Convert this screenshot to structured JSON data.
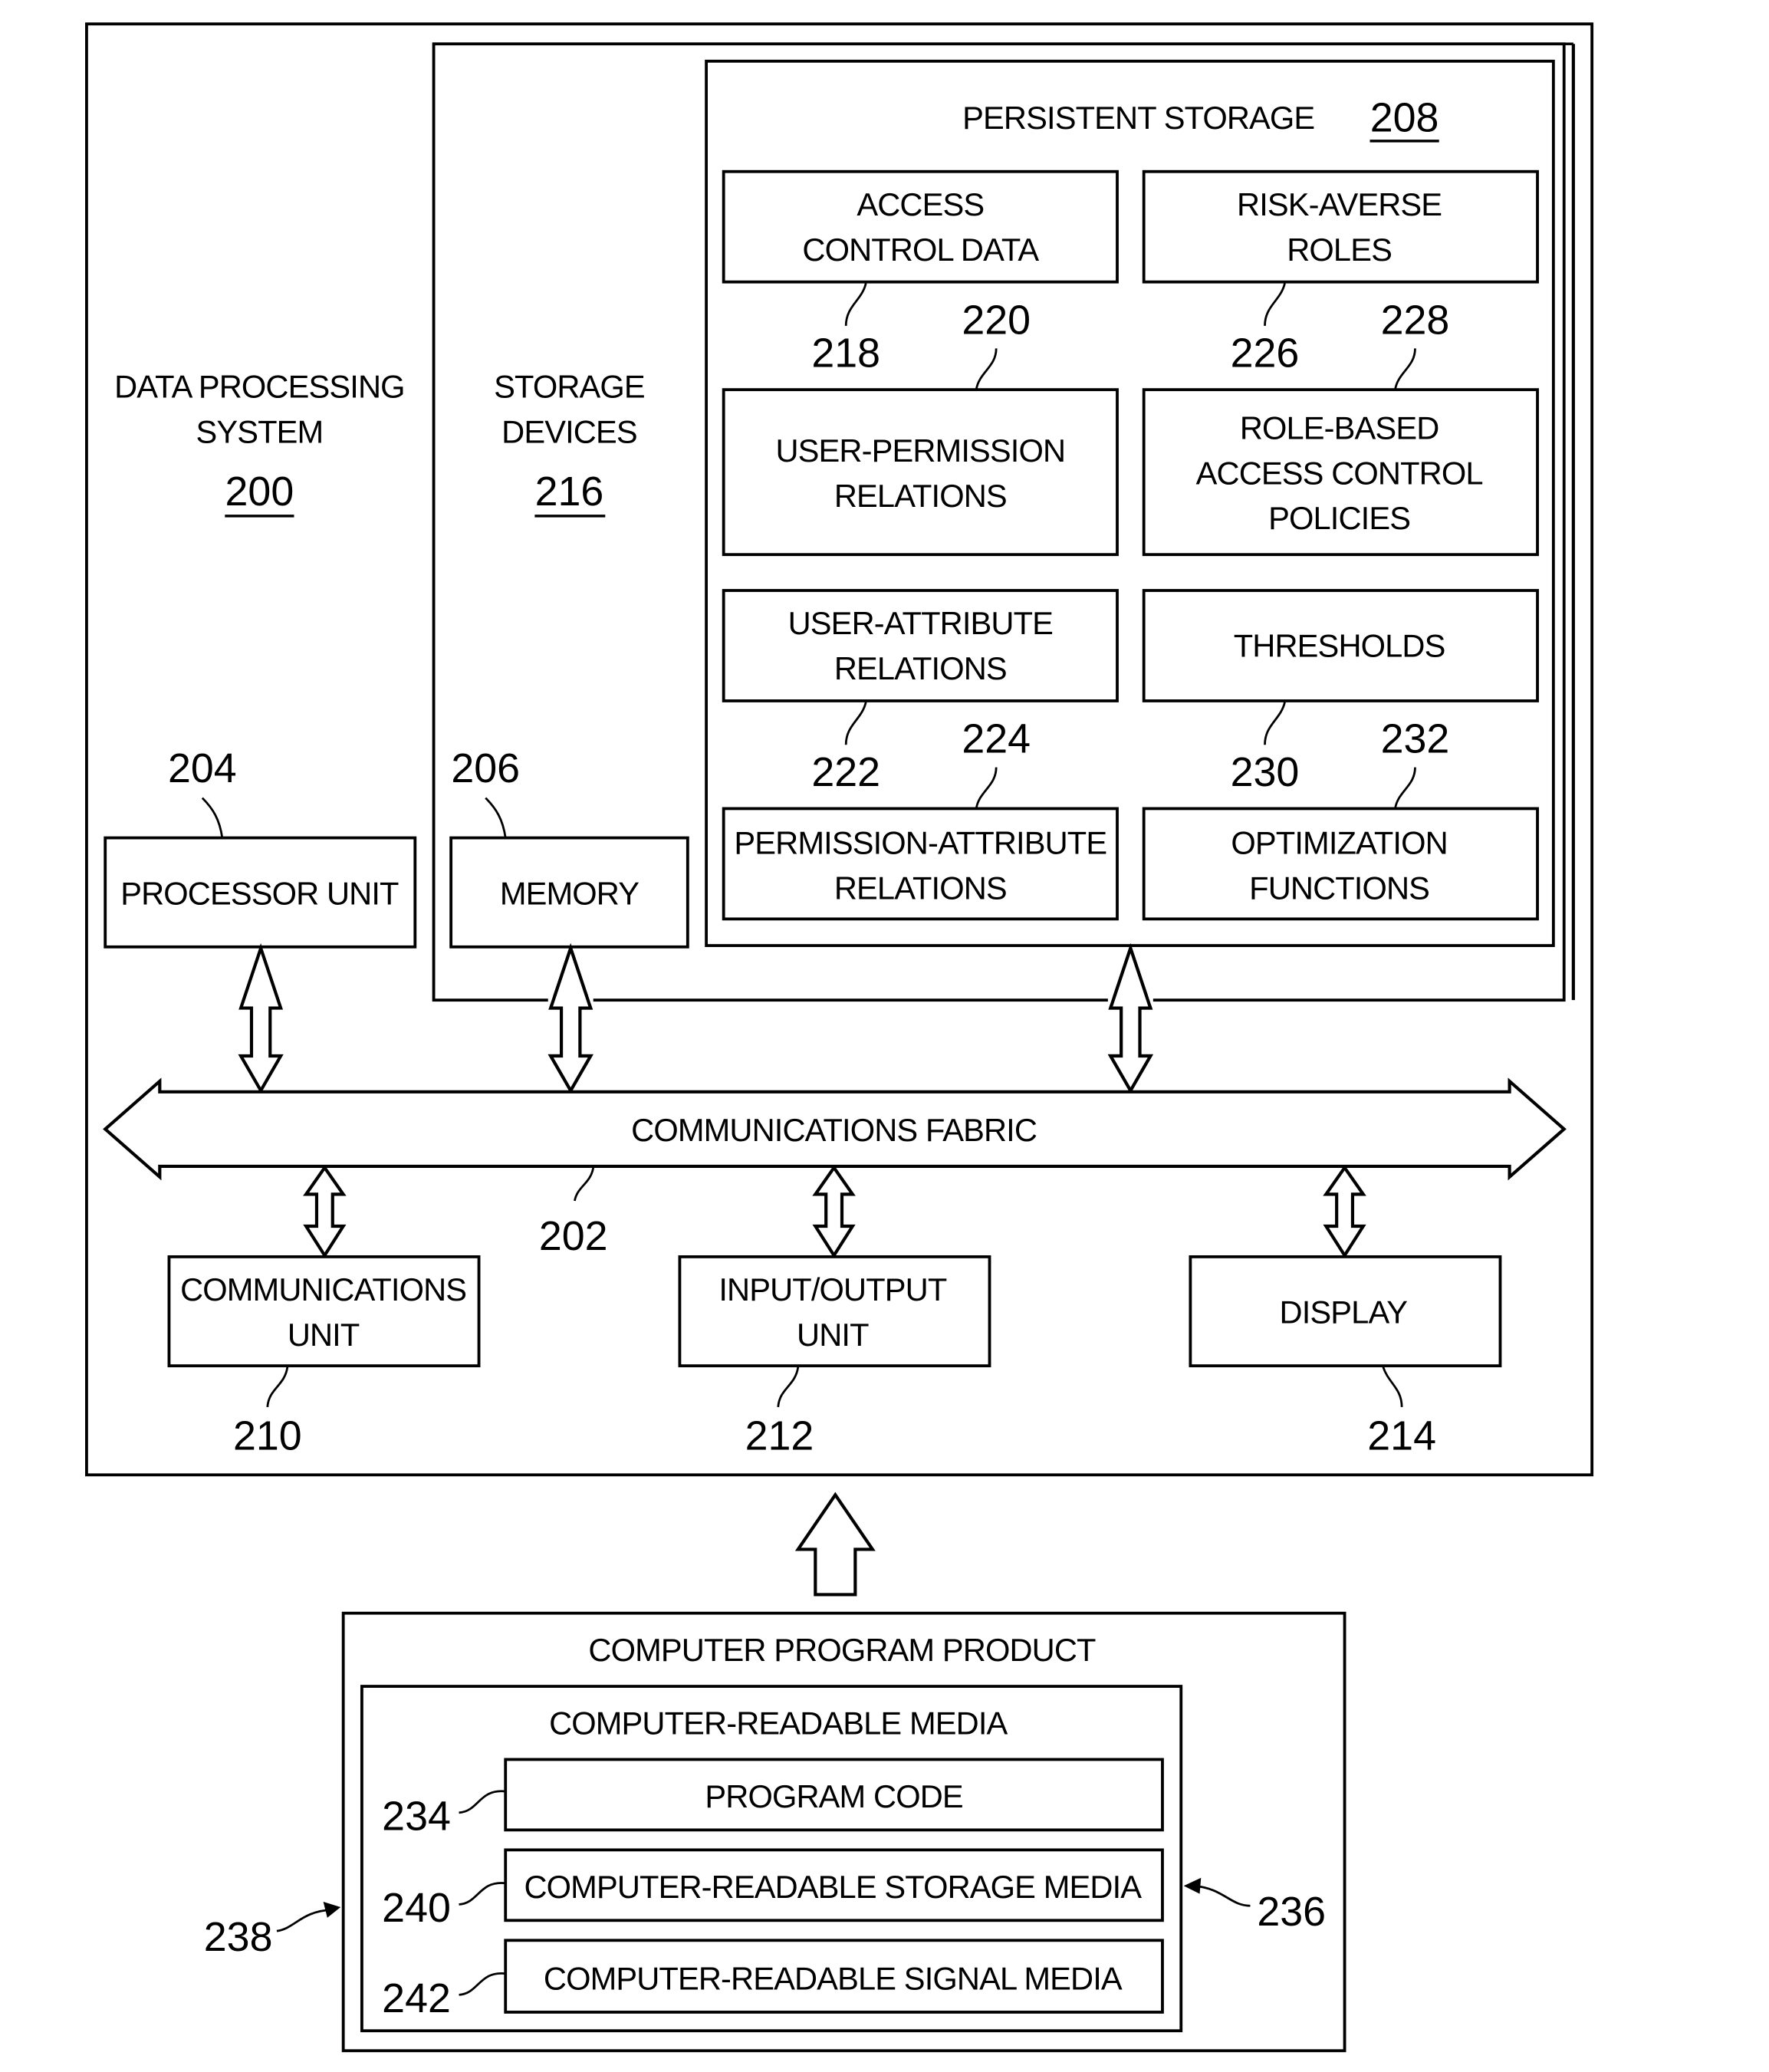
{
  "figure": {
    "data_processing_system": {
      "label_line1": "DATA PROCESSING",
      "label_line2": "SYSTEM",
      "ref": "200"
    },
    "storage_devices": {
      "label_line1": "STORAGE",
      "label_line2": "DEVICES",
      "ref": "216"
    },
    "persistent_storage": {
      "label": "PERSISTENT STORAGE",
      "ref": "208",
      "items": [
        {
          "lines": [
            "ACCESS",
            "CONTROL DATA"
          ],
          "ref": "218"
        },
        {
          "lines": [
            "RISK-AVERSE",
            "ROLES"
          ],
          "ref": "226"
        },
        {
          "lines": [
            "USER-PERMISSION",
            "RELATIONS"
          ],
          "ref": "220"
        },
        {
          "lines": [
            "ROLE-BASED",
            "ACCESS CONTROL",
            "POLICIES"
          ],
          "ref": "228"
        },
        {
          "lines": [
            "USER-ATTRIBUTE",
            "RELATIONS"
          ],
          "ref": "222"
        },
        {
          "lines": [
            "THRESHOLDS"
          ],
          "ref": "230"
        },
        {
          "lines": [
            "PERMISSION-ATTRIBUTE",
            "RELATIONS"
          ],
          "ref": "224"
        },
        {
          "lines": [
            "OPTIMIZATION",
            "FUNCTIONS"
          ],
          "ref": "232"
        }
      ]
    },
    "processor_unit": {
      "label": "PROCESSOR UNIT",
      "ref": "204"
    },
    "memory": {
      "label": "MEMORY",
      "ref": "206"
    },
    "communications_fabric": {
      "label": "COMMUNICATIONS FABRIC",
      "ref": "202"
    },
    "communications_unit": {
      "label_line1": "COMMUNICATIONS",
      "label_line2": "UNIT",
      "ref": "210"
    },
    "io_unit": {
      "label_line1": "INPUT/OUTPUT",
      "label_line2": "UNIT",
      "ref": "212"
    },
    "display": {
      "label": "DISPLAY",
      "ref": "214"
    },
    "computer_program_product": {
      "label": "COMPUTER PROGRAM PRODUCT",
      "ref": "238",
      "media": {
        "label": "COMPUTER-READABLE MEDIA",
        "ref": "236",
        "program_code": {
          "label": "PROGRAM CODE",
          "ref": "234"
        },
        "storage_media": {
          "label": "COMPUTER-READABLE STORAGE MEDIA",
          "ref": "240"
        },
        "signal_media": {
          "label": "COMPUTER-READABLE SIGNAL MEDIA",
          "ref": "242"
        }
      }
    }
  }
}
